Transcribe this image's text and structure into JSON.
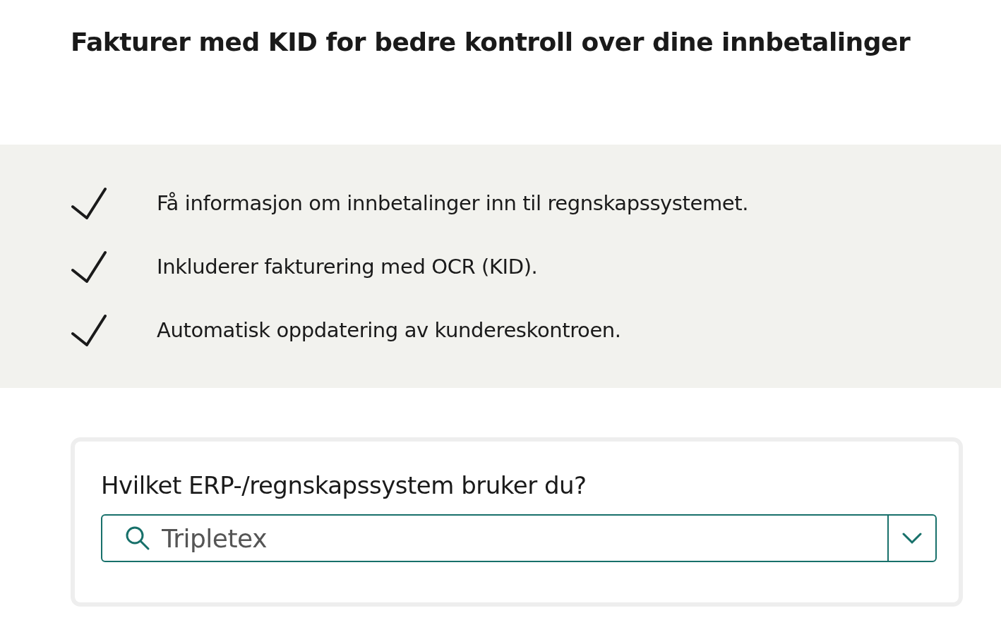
{
  "heading": "Fakturer med KID for bedre kontroll over dine innbetalinger",
  "benefits": [
    "Få informasjon om innbetalinger inn til regnskapssystemet.",
    "Inkluderer fakturering med OCR (KID).",
    "Automatisk oppdatering av kundereskontroen."
  ],
  "question": {
    "label": "Hvilket ERP-/regnskapssystem bruker du?",
    "placeholder": "Tripletex"
  }
}
